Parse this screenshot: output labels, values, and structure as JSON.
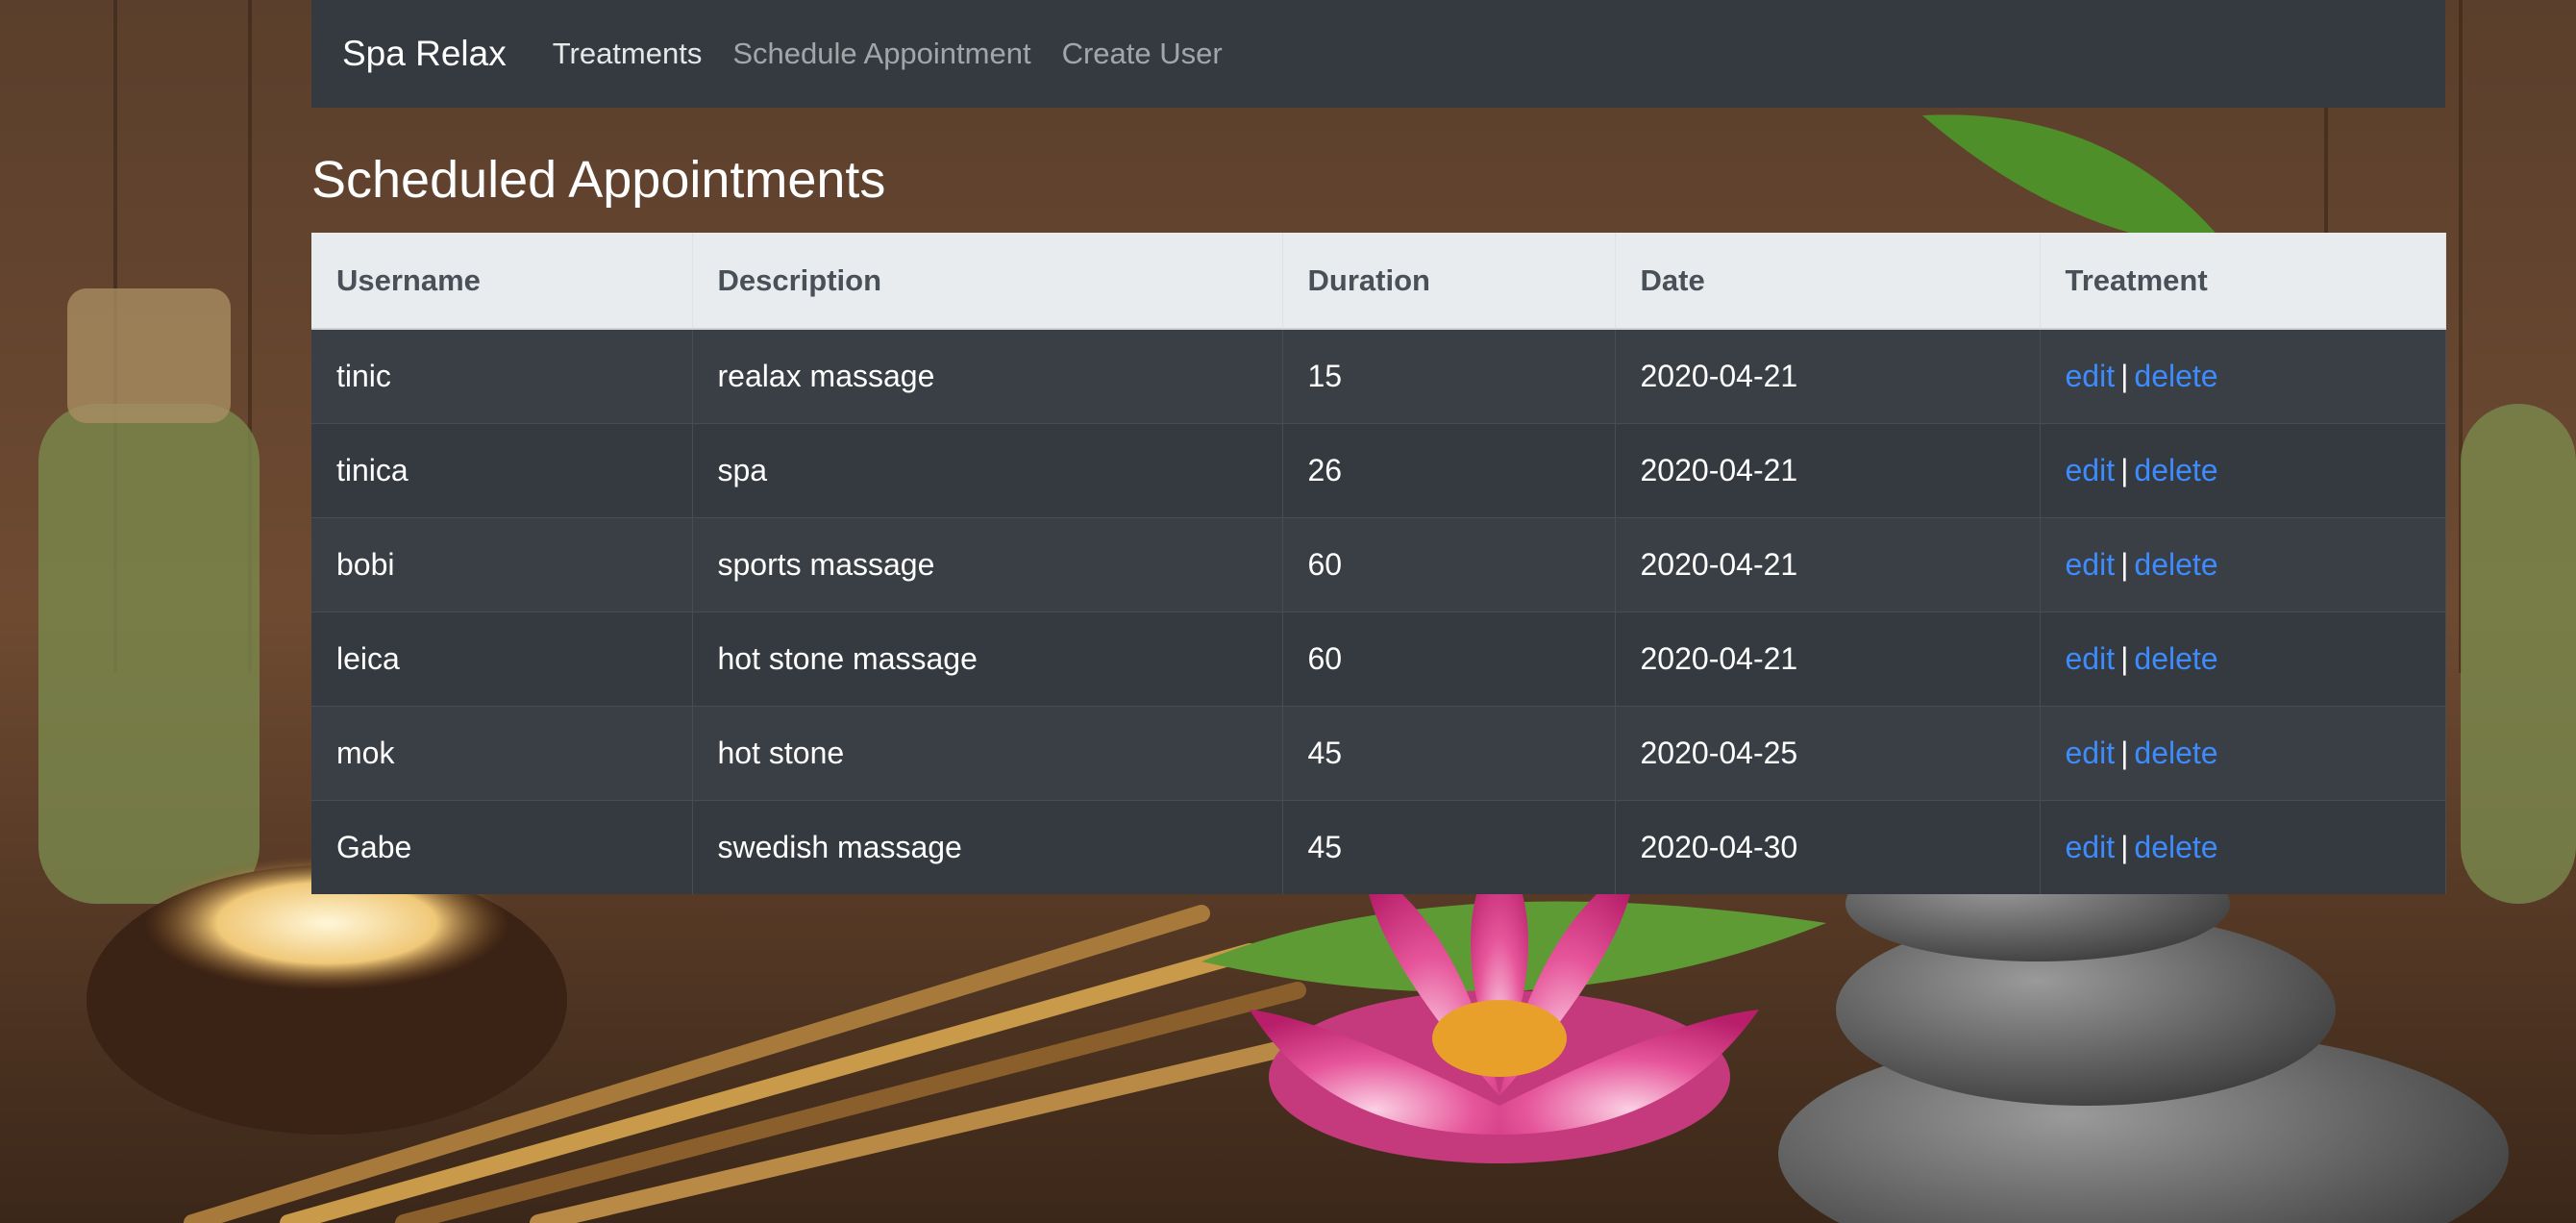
{
  "navbar": {
    "brand": "Spa Relax",
    "links": [
      {
        "label": "Treatments"
      },
      {
        "label": "Schedule Appointment"
      },
      {
        "label": "Create User"
      }
    ]
  },
  "page": {
    "title": "Scheduled Appointments"
  },
  "table": {
    "headers": [
      "Username",
      "Description",
      "Duration",
      "Date",
      "Treatment"
    ],
    "rows": [
      {
        "username": "tinic",
        "description": "realax massage",
        "duration": "15",
        "date": "2020-04-21"
      },
      {
        "username": "tinica",
        "description": "spa",
        "duration": "26",
        "date": "2020-04-21"
      },
      {
        "username": "bobi",
        "description": "sports massage",
        "duration": "60",
        "date": "2020-04-21"
      },
      {
        "username": "leica",
        "description": "hot stone massage",
        "duration": "60",
        "date": "2020-04-21"
      },
      {
        "username": "mok",
        "description": "hot stone",
        "duration": "45",
        "date": "2020-04-25"
      },
      {
        "username": "Gabe",
        "description": "swedish massage",
        "duration": "45",
        "date": "2020-04-30"
      }
    ],
    "actions": {
      "edit_label": "edit",
      "separator": "|",
      "delete_label": "delete"
    }
  },
  "colors": {
    "navbar_bg": "#343a40",
    "link_blue": "#3d8bfd",
    "header_bg": "#e9ecef"
  }
}
